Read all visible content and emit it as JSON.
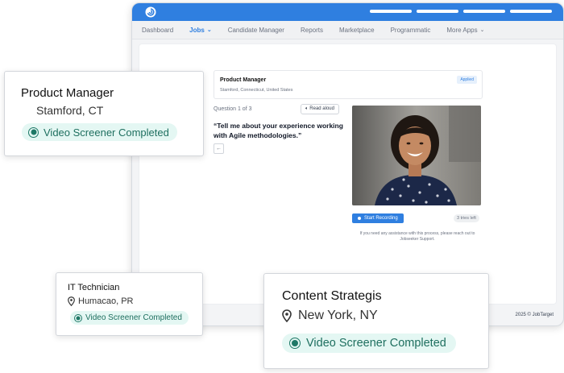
{
  "nav": {
    "items": [
      "Dashboard",
      "Jobs",
      "Candidate Manager",
      "Reports",
      "Marketplace",
      "Programmatic",
      "More Apps"
    ],
    "active": "Jobs"
  },
  "job": {
    "title": "Product Manager",
    "location": "Stamford, Connecticut, United States",
    "status": "Applied"
  },
  "screener": {
    "question_count": "Question 1 of 3",
    "read_aloud": "Read aloud",
    "question": "“Tell me about your experience working with Agile methodologies.”",
    "back_icon": "arrow-left-icon",
    "record_label": "Start Recording",
    "tries": "3 tries left",
    "help_text": "If you need any assistance with this process, please reach out to Jobseeker Support."
  },
  "footer": {
    "copyright": "2025 © JobTarget"
  },
  "cards": [
    {
      "title": "Product Manager",
      "location": "Stamford, CT",
      "status": "Video Screener Completed"
    },
    {
      "title": "IT Technician",
      "location": "Humacao, PR",
      "status": "Video Screener Completed"
    },
    {
      "title": "Content Strategis",
      "location": "New York, NY",
      "status": "Video Screener Completed"
    }
  ],
  "colors": {
    "brand_blue": "#2f7fe0",
    "pill_bg": "#e4f7f3",
    "pill_text": "#1e6f5f"
  }
}
